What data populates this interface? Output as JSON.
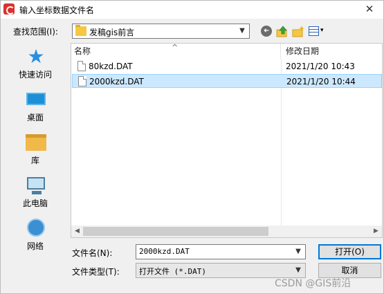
{
  "window": {
    "title": "输入坐标数据文件名",
    "close_glyph": "✕"
  },
  "lookin": {
    "label": "查找范围(I):",
    "value": "发稿gis前言"
  },
  "toolbar": {
    "back_glyph": "➜",
    "up_glyph": "⇧",
    "newfolder_glyph": "✳",
    "view_caret": "▾"
  },
  "places": [
    {
      "label": "快速访问",
      "icon": "quick-access-star-icon"
    },
    {
      "label": "桌面",
      "icon": "desktop-icon"
    },
    {
      "label": "库",
      "icon": "libraries-icon"
    },
    {
      "label": "此电脑",
      "icon": "this-pc-icon"
    },
    {
      "label": "网络",
      "icon": "network-icon"
    }
  ],
  "filelist": {
    "columns": {
      "name": "名称",
      "date": "修改日期"
    },
    "sort_caret": "^",
    "rows": [
      {
        "name": "80kzd.DAT",
        "date": "2021/1/20 10:43",
        "selected": false
      },
      {
        "name": "2000kzd.DAT",
        "date": "2021/1/20 10:44",
        "selected": true
      }
    ],
    "scroll_left": "◀",
    "scroll_right": "▶"
  },
  "filename": {
    "label": "文件名(N):",
    "value": "2000kzd.DAT"
  },
  "filetype": {
    "label": "文件类型(T):",
    "value": "打开文件 (*.DAT)"
  },
  "buttons": {
    "open": "打开(O)",
    "cancel": "取消"
  },
  "watermark": "CSDN @GIS前沿",
  "colors": {
    "selection_bg": "#cce8ff",
    "selection_border": "#99d1ff",
    "default_button_border": "#0078d7"
  }
}
